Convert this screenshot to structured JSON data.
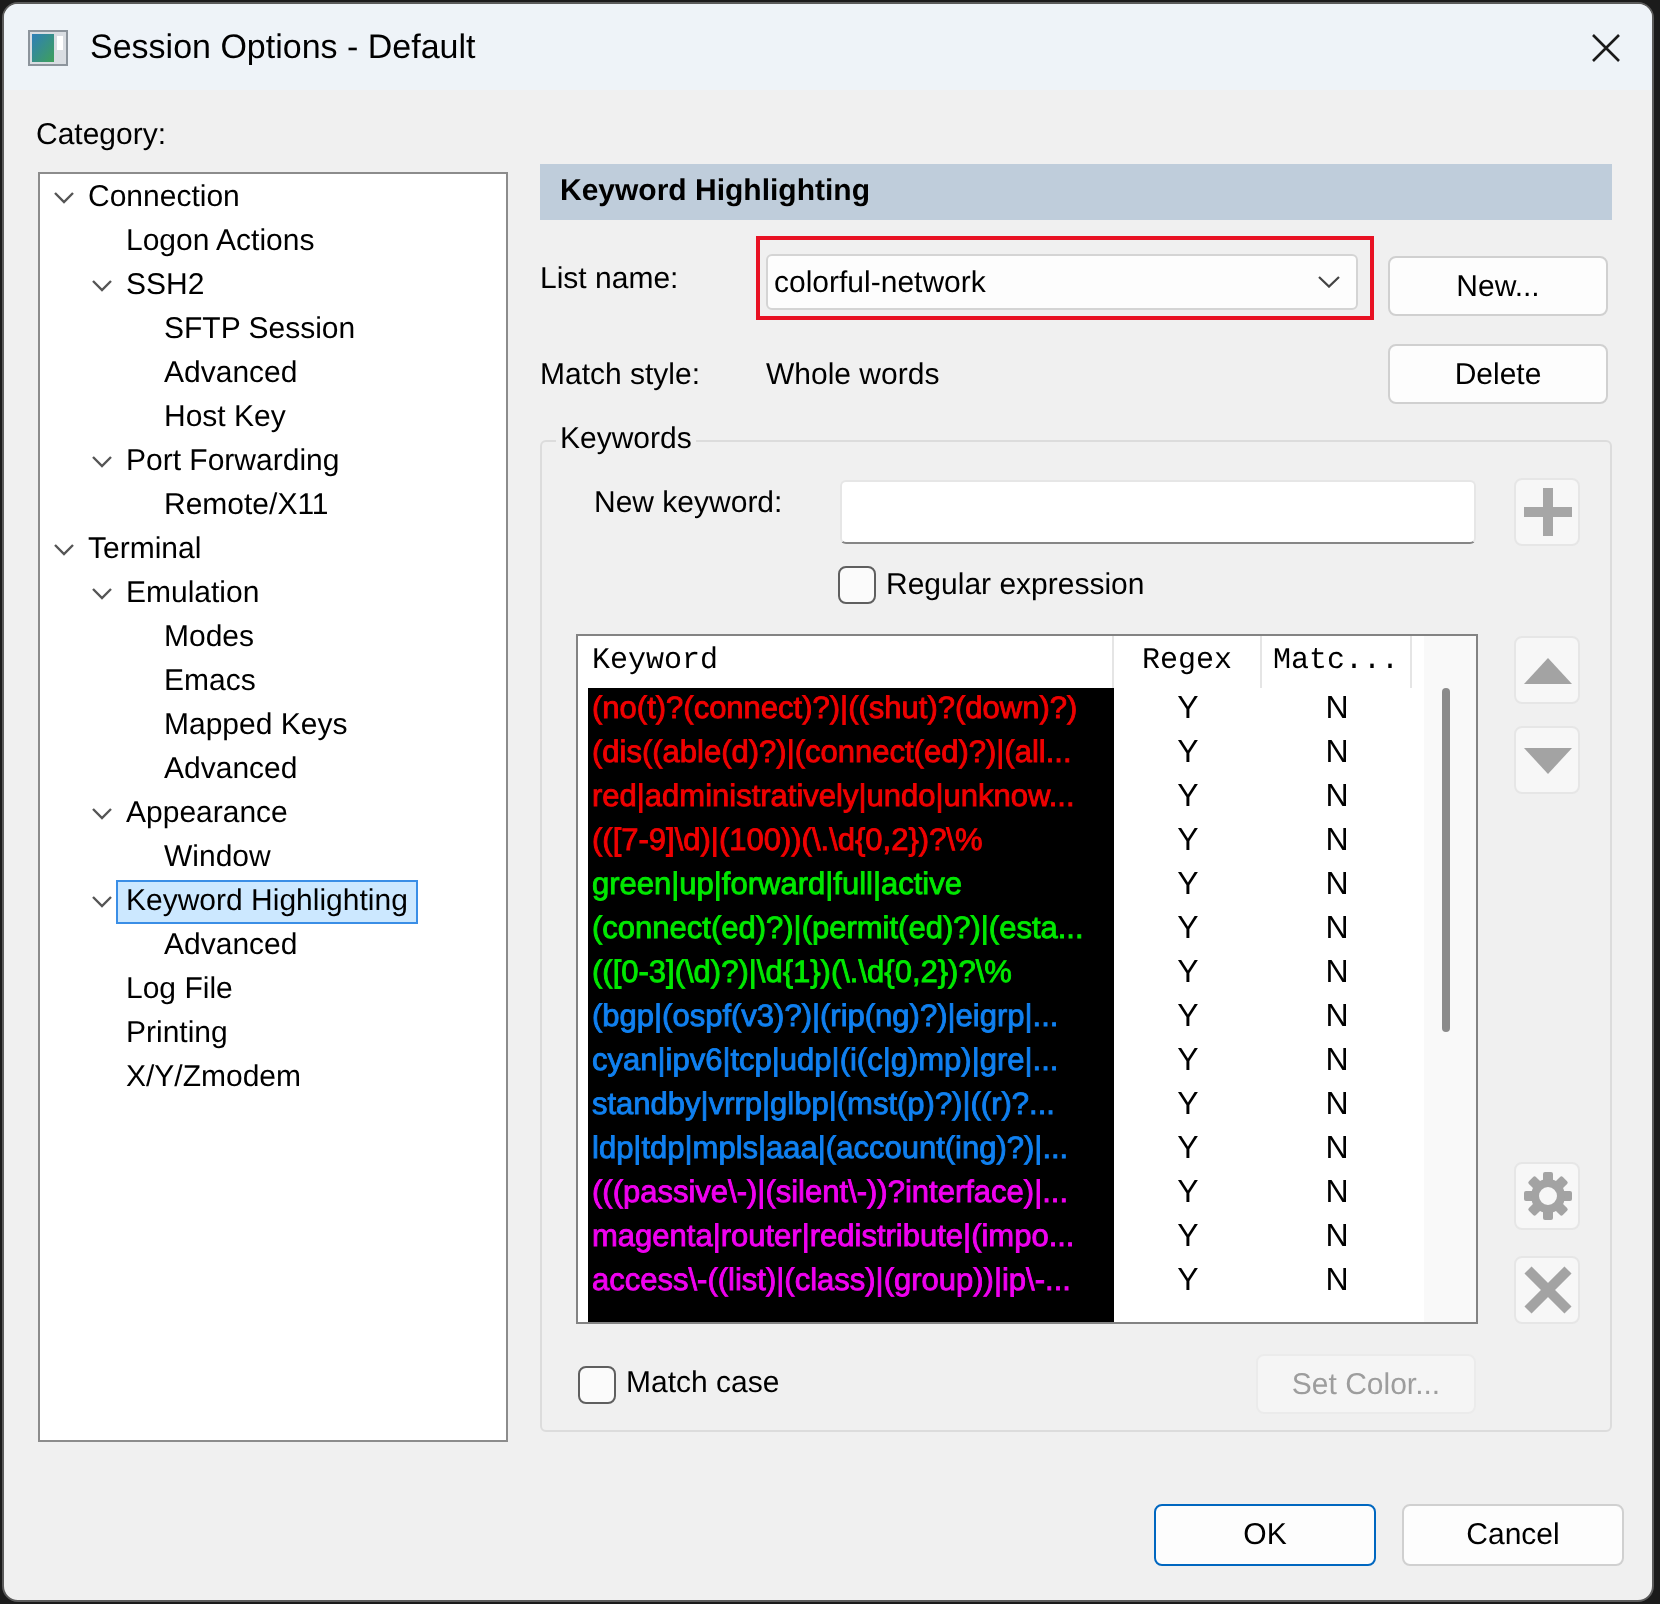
{
  "window": {
    "title": "Session Options - Default"
  },
  "category": {
    "label": "Category:",
    "tree": [
      {
        "label": "Connection",
        "expanded": true,
        "selected": false,
        "children": [
          {
            "label": "Logon Actions",
            "selected": false
          },
          {
            "label": "SSH2",
            "expanded": true,
            "selected": false,
            "children": [
              {
                "label": "SFTP Session",
                "selected": false
              },
              {
                "label": "Advanced",
                "selected": false
              },
              {
                "label": "Host Key",
                "selected": false
              }
            ]
          },
          {
            "label": "Port Forwarding",
            "expanded": true,
            "selected": false,
            "children": [
              {
                "label": "Remote/X11",
                "selected": false
              }
            ]
          }
        ]
      },
      {
        "label": "Terminal",
        "expanded": true,
        "selected": false,
        "children": [
          {
            "label": "Emulation",
            "expanded": true,
            "selected": false,
            "children": [
              {
                "label": "Modes",
                "selected": false
              },
              {
                "label": "Emacs",
                "selected": false
              },
              {
                "label": "Mapped Keys",
                "selected": false
              },
              {
                "label": "Advanced",
                "selected": false
              }
            ]
          },
          {
            "label": "Appearance",
            "expanded": true,
            "selected": false,
            "children": [
              {
                "label": "Window",
                "selected": false
              }
            ]
          },
          {
            "label": "Keyword Highlighting",
            "expanded": true,
            "selected": true,
            "children": [
              {
                "label": "Advanced",
                "selected": false
              }
            ]
          },
          {
            "label": "Log File",
            "selected": false
          },
          {
            "label": "Printing",
            "selected": false
          },
          {
            "label": "X/Y/Zmodem",
            "selected": false
          }
        ]
      }
    ]
  },
  "panel": {
    "title": "Keyword Highlighting",
    "list_name": {
      "label": "List name:",
      "value": "colorful-network",
      "highlighted": true
    },
    "new_button": "New...",
    "match_style": {
      "label": "Match style:",
      "value": "Whole words"
    },
    "delete_button": "Delete",
    "keywords": {
      "title": "Keywords",
      "new_keyword": {
        "label": "New keyword:"
      },
      "regular_expression": {
        "label": "Regular expression",
        "checked": false
      },
      "table": {
        "columns": [
          "Keyword",
          "Regex",
          "Matc..."
        ],
        "rows": [
          {
            "keyword": "(no(t)?(connect)?)|((shut)?(down)?)",
            "color": "#f00000",
            "regex": "Y",
            "match_case": "N",
            "selected": false
          },
          {
            "keyword": "(dis((able(d)?)|(connect(ed)?)|(all...",
            "color": "#f00000",
            "regex": "Y",
            "match_case": "N",
            "selected": false
          },
          {
            "keyword": "red|administratively|undo|unknow...",
            "color": "#f00000",
            "regex": "Y",
            "match_case": "N",
            "selected": false
          },
          {
            "keyword": "(([7-9]\\d)|(100))(\\.\\d{0,2})?\\%",
            "color": "#f00000",
            "regex": "Y",
            "match_case": "N",
            "selected": false
          },
          {
            "keyword": "green|up|forward|full|active",
            "color": "#00e800",
            "regex": "Y",
            "match_case": "N",
            "selected": false
          },
          {
            "keyword": "(connect(ed)?)|(permit(ed)?)|(esta...",
            "color": "#00e800",
            "regex": "Y",
            "match_case": "N",
            "selected": false
          },
          {
            "keyword": "(([0-3](\\d)?)|\\d{1})(\\.\\d{0,2})?\\%",
            "color": "#00e800",
            "regex": "Y",
            "match_case": "N",
            "selected": false
          },
          {
            "keyword": "(bgp|(ospf(v3)?)|(rip(ng)?)|eigrp|...",
            "color": "#1080f0",
            "regex": "Y",
            "match_case": "N",
            "selected": false
          },
          {
            "keyword": "cyan|ipv6|tcp|udp|(i(c|g)mp)|gre|...",
            "color": "#1080f0",
            "regex": "Y",
            "match_case": "N",
            "selected": false
          },
          {
            "keyword": "standby|vrrp|glbp|(mst(p)?)|((r)?...",
            "color": "#1080f0",
            "regex": "Y",
            "match_case": "N",
            "selected": false
          },
          {
            "keyword": "ldp|tdp|mpls|aaa|(account(ing)?)|...",
            "color": "#1080f0",
            "regex": "Y",
            "match_case": "N",
            "selected": false
          },
          {
            "keyword": "(((passive\\-)|(silent\\-))?interface)|...",
            "color": "#f000f0",
            "regex": "Y",
            "match_case": "N",
            "selected": false
          },
          {
            "keyword": "magenta|router|redistribute|(impo...",
            "color": "#f000f0",
            "regex": "Y",
            "match_case": "N",
            "selected": false
          },
          {
            "keyword": "access\\-((list)|(class)|(group))|ip\\-...",
            "color": "#f000f0",
            "regex": "Y",
            "match_case": "N",
            "selected": false
          }
        ]
      },
      "match_case": {
        "label": "Match case",
        "checked": false
      },
      "set_color": {
        "label": "Set Color...",
        "disabled": true
      }
    }
  },
  "buttons": [
    {
      "label": "OK",
      "default": true
    },
    {
      "label": "Cancel",
      "default": false
    }
  ]
}
